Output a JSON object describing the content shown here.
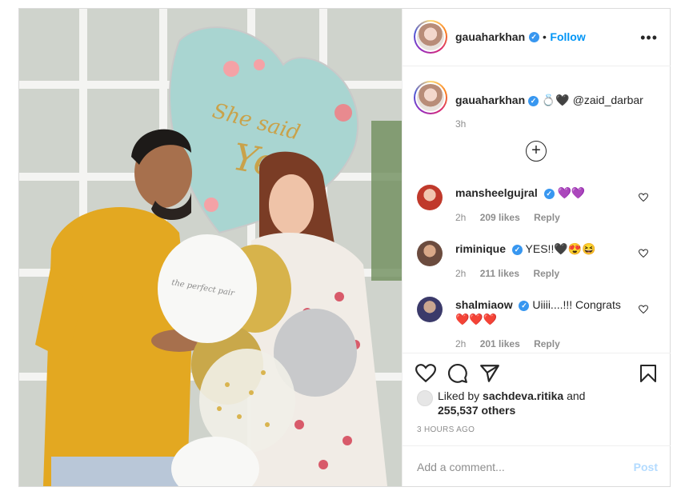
{
  "post": {
    "author": "gauaharkhan",
    "dot": "•",
    "follow_label": "Follow",
    "more_label": "•••",
    "verified_mark": "✓"
  },
  "caption": {
    "username": "gauaharkhan",
    "emoji": "💍🖤",
    "mention": "@zaid_darbar",
    "time": "3h"
  },
  "load_more_label": "+",
  "balloon_text": [
    "She said",
    "Yes"
  ],
  "balloon_small_text": "the perfect pair",
  "comments": [
    {
      "username": "mansheelgujral",
      "text": "💜💜",
      "time": "2h",
      "likes": "209 likes",
      "reply": "Reply",
      "avatar_color": "#c0392b"
    },
    {
      "username": "riminique",
      "text": "YES!!🖤😍😆",
      "time": "2h",
      "likes": "211 likes",
      "reply": "Reply",
      "avatar_color": "#6b4b3e"
    },
    {
      "username": "shalmiaow",
      "text": "Uiiii....!!! Congrats",
      "text2": "❤️❤️❤️",
      "time": "2h",
      "likes": "201 likes",
      "reply": "Reply",
      "avatar_color": "#3b3a6a"
    }
  ],
  "likes": {
    "prefix": "Liked by",
    "user": "sachdeva.ritika",
    "conj": "and",
    "count": "255,537 others"
  },
  "timestamp": "3 HOURS AGO",
  "comment_input": {
    "placeholder": "Add a comment...",
    "value": ""
  },
  "post_label": "Post",
  "icons": [
    "heart-icon",
    "comment-icon",
    "share-icon",
    "bookmark-icon",
    "more-icon",
    "add-icon",
    "verified-icon"
  ]
}
